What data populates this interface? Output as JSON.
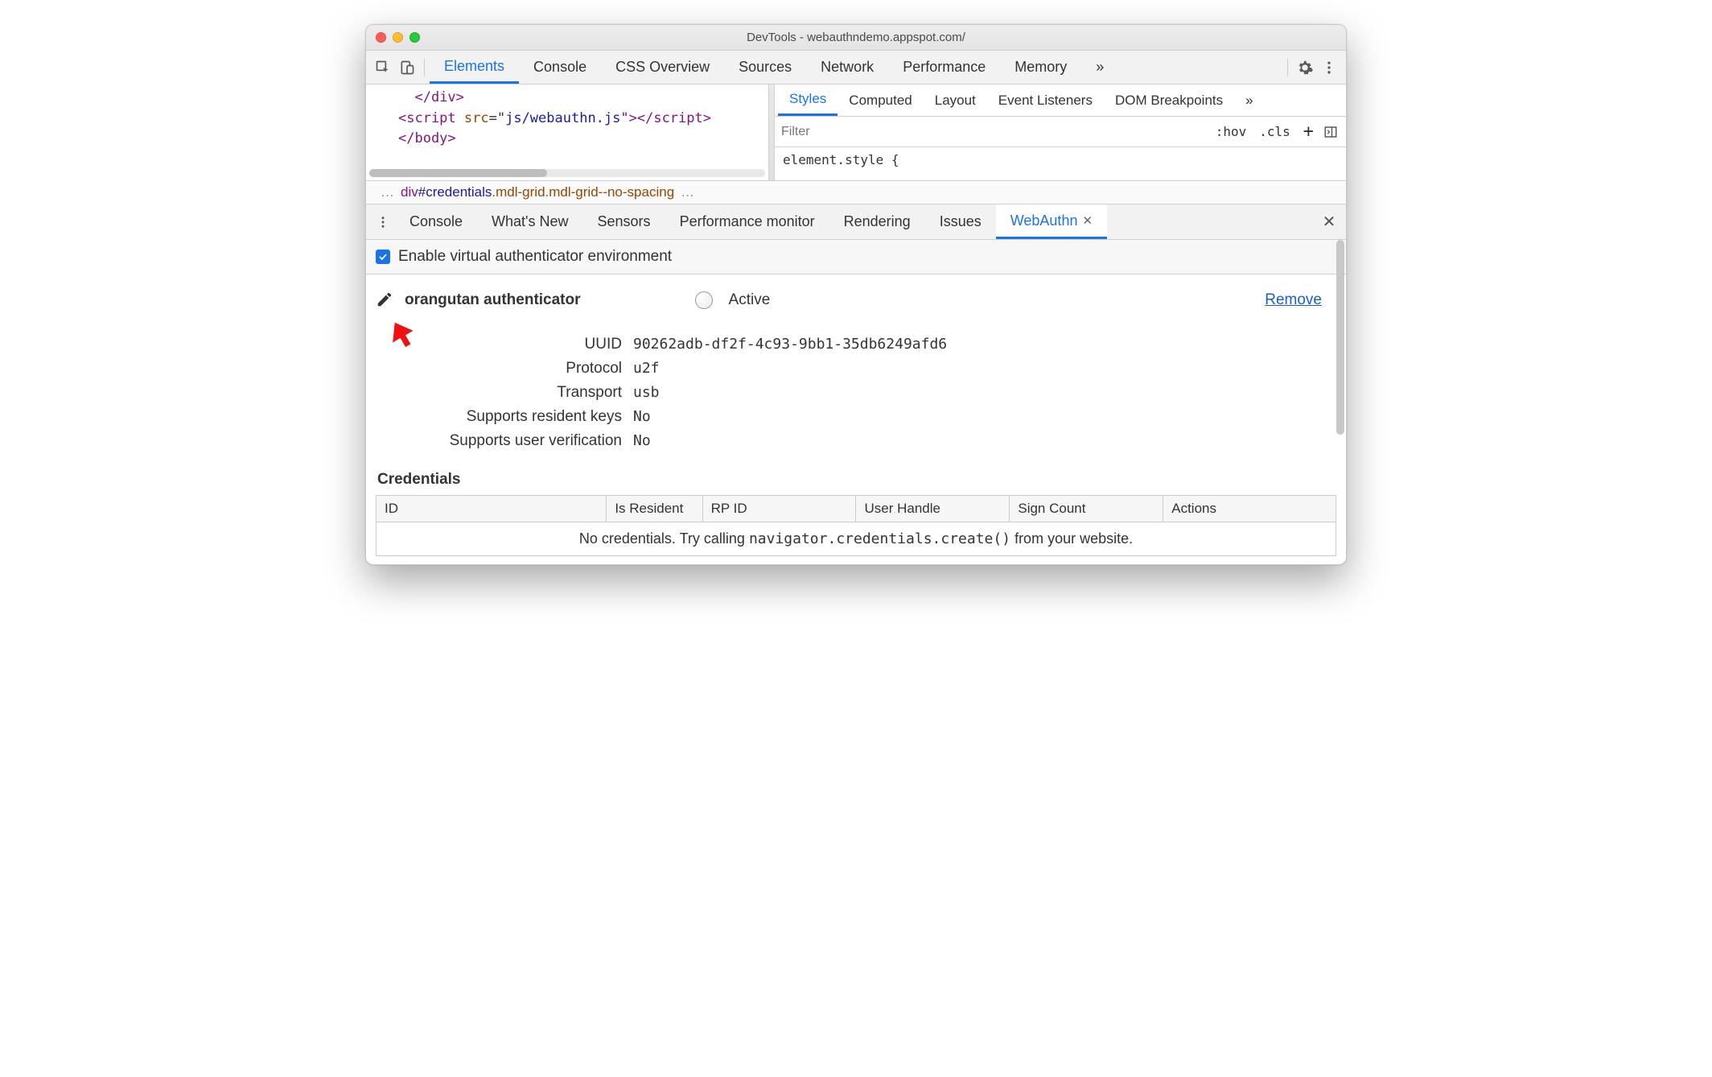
{
  "window": {
    "title": "DevTools - webauthndemo.appspot.com/"
  },
  "main_tabs": {
    "items": [
      "Elements",
      "Console",
      "CSS Overview",
      "Sources",
      "Network",
      "Performance",
      "Memory"
    ],
    "active_index": 0,
    "overflow_glyph": "»"
  },
  "code": {
    "line1_close_div": "</div>",
    "line2_open": "<script ",
    "line2_attr": "src",
    "line2_eq": "=\"",
    "line2_val": "js/webauthn.js",
    "line2_close": "\"></scr",
    "line2_close2": "ipt>",
    "line3_close_body": "</body>"
  },
  "breadcrumb": {
    "prefix_ell": "…",
    "tag": "div",
    "id": "#credentials",
    "cls": ".mdl-grid.mdl-grid--no-spacing",
    "suffix_ell": "…"
  },
  "styles": {
    "tabs": [
      "Styles",
      "Computed",
      "Layout",
      "Event Listeners",
      "DOM Breakpoints"
    ],
    "active_index": 0,
    "overflow_glyph": "»",
    "filter_placeholder": "Filter",
    "hov": ":hov",
    "cls": ".cls",
    "plus": "+",
    "body_text": "element.style {"
  },
  "drawer": {
    "tabs": [
      "Console",
      "What's New",
      "Sensors",
      "Performance monitor",
      "Rendering",
      "Issues",
      "WebAuthn"
    ],
    "active_index": 6
  },
  "enable": {
    "label": "Enable virtual authenticator environment",
    "checked": true
  },
  "authenticator": {
    "name": "orangutan authenticator",
    "active_label": "Active",
    "remove_label": "Remove",
    "fields": {
      "uuid_label": "UUID",
      "uuid": "90262adb-df2f-4c93-9bb1-35db6249afd6",
      "protocol_label": "Protocol",
      "protocol": "u2f",
      "transport_label": "Transport",
      "transport": "usb",
      "resident_label": "Supports resident keys",
      "resident": "No",
      "uv_label": "Supports user verification",
      "uv": "No"
    }
  },
  "credentials": {
    "title": "Credentials",
    "columns": [
      "ID",
      "Is Resident",
      "RP ID",
      "User Handle",
      "Sign Count",
      "Actions"
    ],
    "empty_prefix": "No credentials. Try calling ",
    "empty_code": "navigator.credentials.create()",
    "empty_suffix": " from your website."
  }
}
